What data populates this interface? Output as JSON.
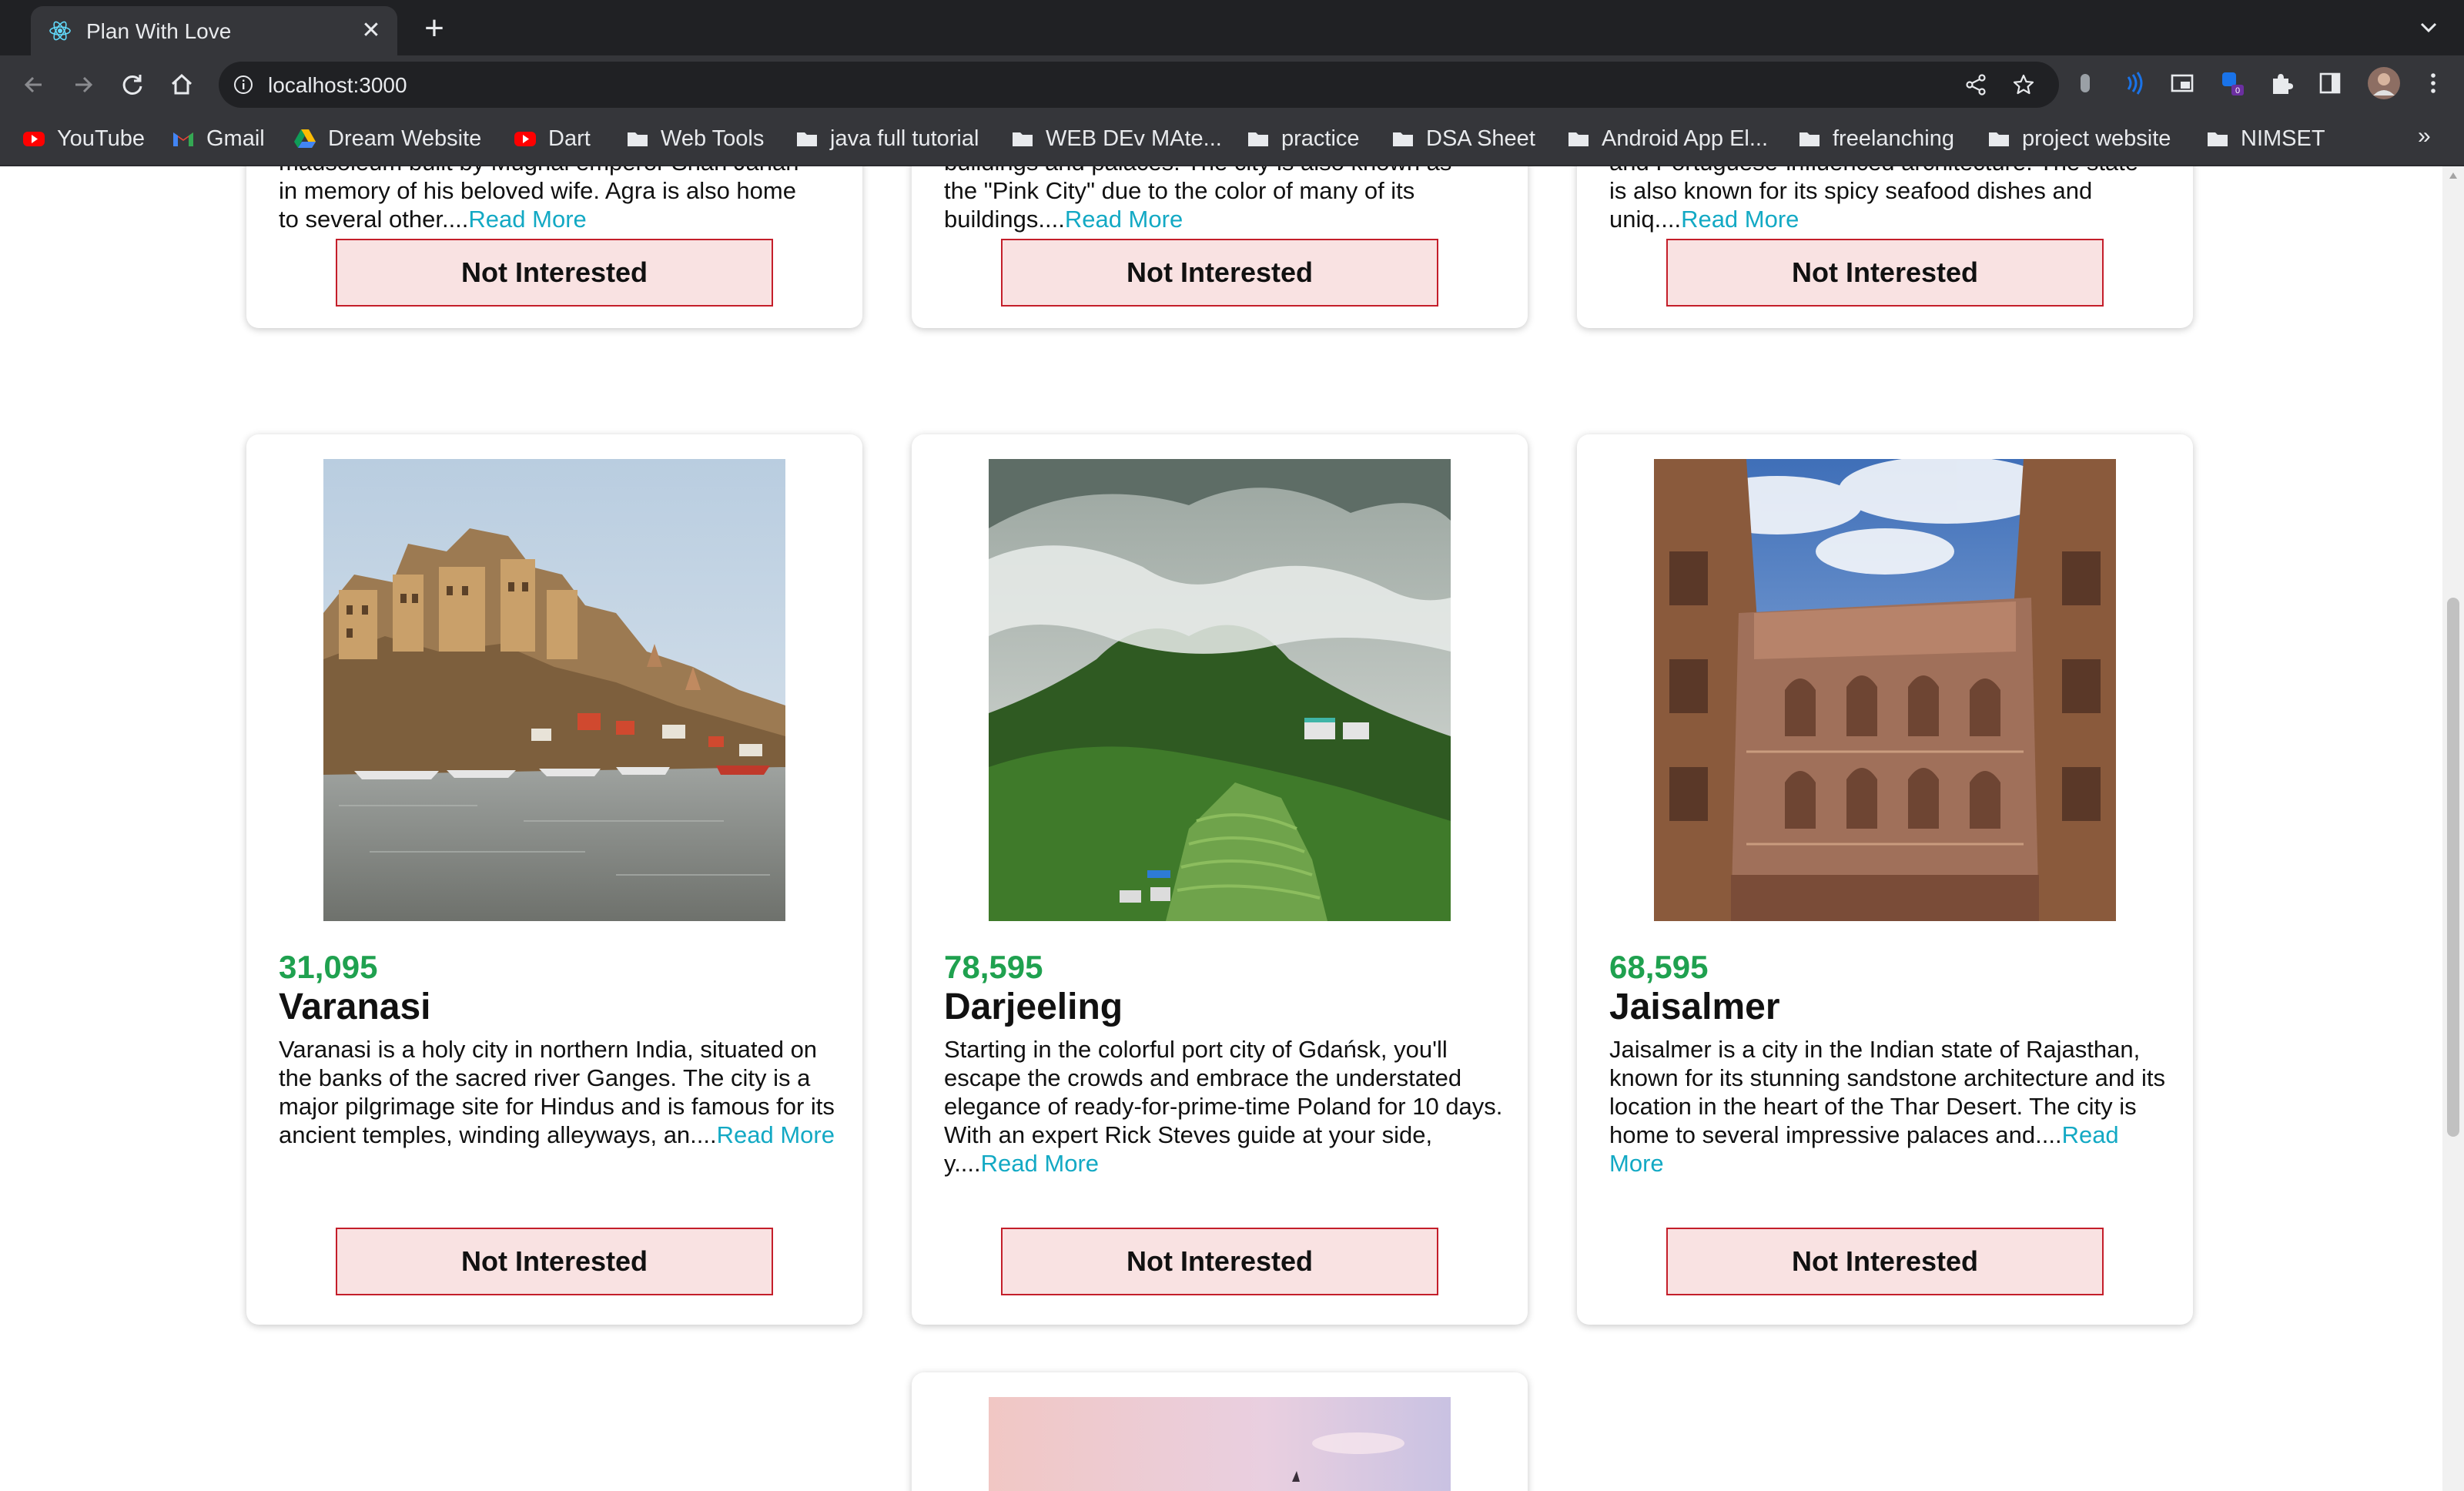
{
  "browser": {
    "tab_title": "Plan With Love",
    "new_tab": "+",
    "close": "✕",
    "url": "localhost:3000",
    "bookmarks": [
      {
        "label": "YouTube",
        "icon": "youtube-icon"
      },
      {
        "label": "Gmail",
        "icon": "gmail-icon"
      },
      {
        "label": "Dream Website",
        "icon": "drive-icon"
      },
      {
        "label": "Dart",
        "icon": "youtube-icon"
      },
      {
        "label": "Web Tools",
        "icon": "folder-icon"
      },
      {
        "label": "java full tutorial",
        "icon": "folder-icon"
      },
      {
        "label": "WEB DEv MAte...",
        "icon": "folder-icon"
      },
      {
        "label": "practice",
        "icon": "folder-icon"
      },
      {
        "label": "DSA Sheet",
        "icon": "folder-icon"
      },
      {
        "label": "Android App El...",
        "icon": "folder-icon"
      },
      {
        "label": "freelanching",
        "icon": "folder-icon"
      },
      {
        "label": "project website",
        "icon": "folder-icon"
      },
      {
        "label": "NIMSET",
        "icon": "folder-icon"
      }
    ],
    "more_bookmarks": "»",
    "extension_badge": "0"
  },
  "top_cards": [
    {
      "desc_lines": [
        "mausoleum built by Mughal emperor Shah Jahan",
        "in memory of his beloved wife. Agra is also home",
        "to several other...."
      ],
      "read_more": "Read More",
      "button": "Not Interested"
    },
    {
      "desc_lines": [
        "buildings and palaces. The city is also known as",
        "the \"Pink City\" due to the color of many of its",
        "buildings...."
      ],
      "read_more": "Read More",
      "button": "Not Interested"
    },
    {
      "desc_lines": [
        "and Portuguese-influenced architecture. The state",
        "is also known for its spicy seafood dishes and",
        "uniq...."
      ],
      "read_more": "Read More",
      "button": "Not Interested"
    }
  ],
  "tours": [
    {
      "price": "31,095",
      "name": "Varanasi",
      "description": "Varanasi is a holy city in northern India, situated on the banks of the sacred river Ganges. The city is a major pilgrimage site for Hindus and is famous for its ancient temples, winding alleyways, an....",
      "read_more": "Read More",
      "button": "Not Interested",
      "image": "varanasi-ghats-photo"
    },
    {
      "price": "78,595",
      "name": "Darjeeling",
      "description": "Starting in the colorful port city of Gdańsk, you'll escape the crowds and embrace the understated elegance of ready-for-prime-time Poland for 10 days. With an expert Rick Steves guide at your side, y....",
      "read_more": "Read More",
      "button": "Not Interested",
      "image": "darjeeling-hills-photo"
    },
    {
      "price": "68,595",
      "name": "Jaisalmer",
      "description": "Jaisalmer is a city in the Indian state of Rajasthan, known for its stunning sandstone architecture and its location in the heart of the Thar Desert. The city is home to several impressive palaces and....",
      "read_more": "Read More",
      "button": "Not Interested",
      "image": "jaisalmer-palace-photo"
    }
  ],
  "colors": {
    "price_green": "#1fa14f",
    "read_more_teal": "#13a9c4",
    "button_bg": "#f9e2e2",
    "button_border": "#c41e2a"
  }
}
